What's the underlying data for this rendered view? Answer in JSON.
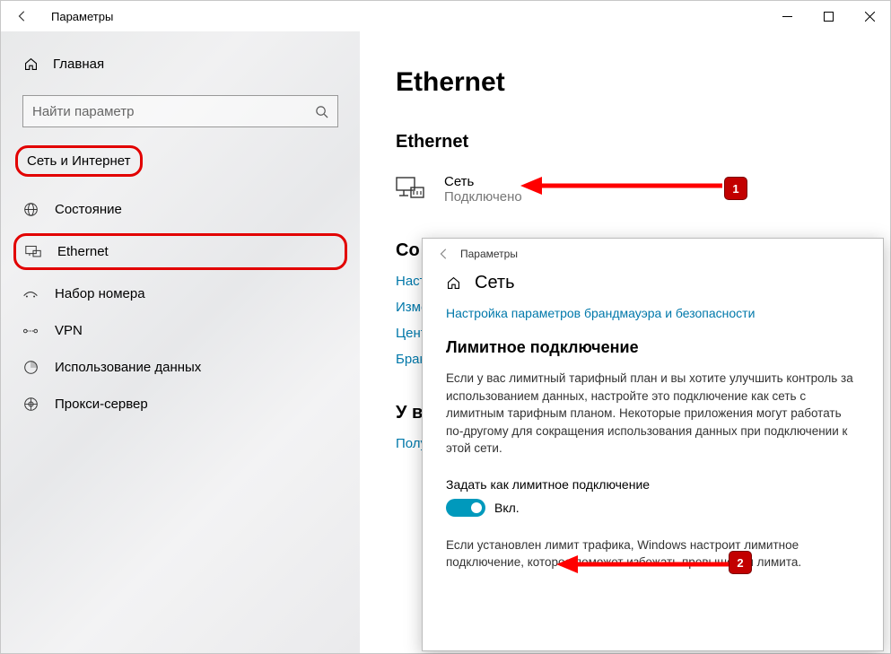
{
  "titlebar": {
    "title": "Параметры"
  },
  "sidebar": {
    "home": "Главная",
    "search_placeholder": "Найти параметр",
    "category": "Сеть и Интернет",
    "items": [
      {
        "label": "Состояние",
        "icon": "globe-icon"
      },
      {
        "label": "Ethernet",
        "icon": "ethernet-icon",
        "highlighted": true
      },
      {
        "label": "Набор номера",
        "icon": "dialup-icon"
      },
      {
        "label": "VPN",
        "icon": "vpn-icon"
      },
      {
        "label": "Использование данных",
        "icon": "data-usage-icon"
      },
      {
        "label": "Прокси-сервер",
        "icon": "proxy-icon"
      }
    ]
  },
  "main": {
    "h1": "Ethernet",
    "h2": "Ethernet",
    "connection": {
      "name": "Сеть",
      "status": "Подключено"
    },
    "section_related_h": "Со",
    "links": [
      "Наст",
      "Изме",
      "Цент",
      "Бран"
    ],
    "section_help_h": "У ва",
    "help_link": "Полу"
  },
  "overlay": {
    "title": "Параметры",
    "home_label": "Сеть",
    "link": "Настройка параметров брандмауэра и безопасности",
    "section_h": "Лимитное подключение",
    "paragraph": "Если у вас лимитный тарифный план и вы хотите улучшить контроль за использованием данных, настройте это подключение как сеть с лимитным тарифным планом. Некоторые приложения могут работать по-другому для сокращения использования данных при подключении к этой сети.",
    "toggle_label": "Задать как лимитное подключение",
    "toggle_state": "Вкл.",
    "note": "Если установлен лимит трафика, Windows настроит лимитное подключение, которое поможет избежать превышения лимита."
  },
  "annotations": {
    "badge1": "1",
    "badge2": "2"
  }
}
